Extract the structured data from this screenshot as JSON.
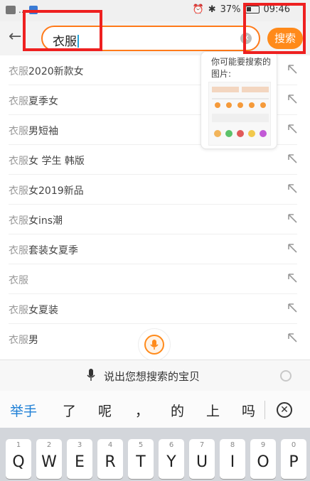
{
  "status_bar": {
    "left_text": "...",
    "battery_percent": "37%",
    "time": "09:46"
  },
  "header": {
    "back_icon": "back-arrow-icon",
    "search_value": "衣服",
    "search_button": "搜索"
  },
  "suggestions": [
    {
      "prefix": "衣服",
      "rest": "2020新款女"
    },
    {
      "prefix": "衣服",
      "rest": "夏季女"
    },
    {
      "prefix": "衣服",
      "rest": "男短袖"
    },
    {
      "prefix": "衣服",
      "rest": "女 学生 韩版"
    },
    {
      "prefix": "衣服",
      "rest": "女2019新品"
    },
    {
      "prefix": "衣服",
      "rest": "女ins潮"
    },
    {
      "prefix": "衣服",
      "rest": "套装女夏季"
    },
    {
      "prefix": "衣服",
      "rest": ""
    },
    {
      "prefix": "衣服",
      "rest": "女夏装"
    },
    {
      "prefix": "衣服",
      "rest": "男"
    }
  ],
  "image_card": {
    "title": "你可能要搜索的图片:"
  },
  "voice": {
    "prompt": "说出您想搜索的宝贝"
  },
  "candidates": [
    "举手",
    "了",
    "呢",
    "，",
    "的",
    "上",
    "吗"
  ],
  "keyboard": {
    "keys": [
      {
        "num": "1",
        "ch": "Q"
      },
      {
        "num": "2",
        "ch": "W"
      },
      {
        "num": "3",
        "ch": "E"
      },
      {
        "num": "4",
        "ch": "R"
      },
      {
        "num": "5",
        "ch": "T"
      },
      {
        "num": "6",
        "ch": "Y"
      },
      {
        "num": "7",
        "ch": "U"
      },
      {
        "num": "8",
        "ch": "I"
      },
      {
        "num": "9",
        "ch": "O"
      },
      {
        "num": "0",
        "ch": "P"
      }
    ]
  },
  "colors": {
    "accent": "#ff8a1a",
    "annotation": "#ee2020",
    "candidate_highlight": "#1e7fd6"
  }
}
